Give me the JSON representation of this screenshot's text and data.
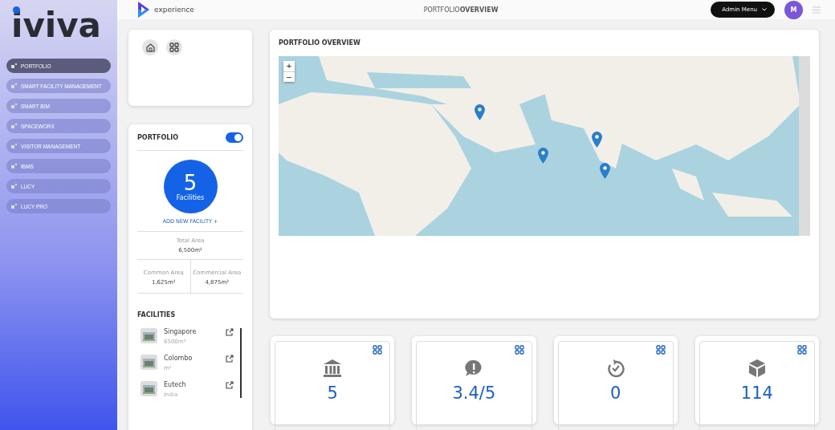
{
  "sidebar": {
    "logo": "iviva",
    "items": [
      {
        "label": "PORTFOLIO",
        "selected": true
      },
      {
        "label": "SMART FACILITY MANAGEMENT",
        "selected": false
      },
      {
        "label": "SMART BIM",
        "selected": false
      },
      {
        "label": "SPACEWORX",
        "selected": false
      },
      {
        "label": "VISITOR MANAGEMENT",
        "selected": false
      },
      {
        "label": "IBMS",
        "selected": false
      },
      {
        "label": "LUCY",
        "selected": false
      },
      {
        "label": "LUCY PRO",
        "selected": false
      }
    ]
  },
  "header": {
    "brand": "experience",
    "title_light": "PORTFOLIO",
    "title_bold": "OVERVIEW",
    "admin_menu": "Admin Menu",
    "avatar": "M"
  },
  "portfolio": {
    "title": "PORTFOLIO",
    "toggle_on": true,
    "count": "5",
    "count_label": "Facilities",
    "add_link": "ADD NEW FACILITY +",
    "total_area_label": "Total Area",
    "total_area": "6,500m²",
    "common_area_label": "Common Area",
    "common_area": "1,625m²",
    "commercial_area_label": "Commercial Area",
    "commercial_area": "4,875m²",
    "facilities_title": "FACILITIES",
    "facilities": [
      {
        "name": "Singapore",
        "area": "6500m²"
      },
      {
        "name": "Colombo",
        "area": "m²"
      },
      {
        "name": "Eutech",
        "area": "India"
      }
    ]
  },
  "map": {
    "title": "PORTFOLIO OVERVIEW",
    "zoom_in": "+",
    "zoom_out": "−",
    "kind": "picture"
  },
  "stats": [
    {
      "value": "5"
    },
    {
      "value": "3.4/5"
    },
    {
      "value": "0"
    },
    {
      "value": "114"
    }
  ]
}
